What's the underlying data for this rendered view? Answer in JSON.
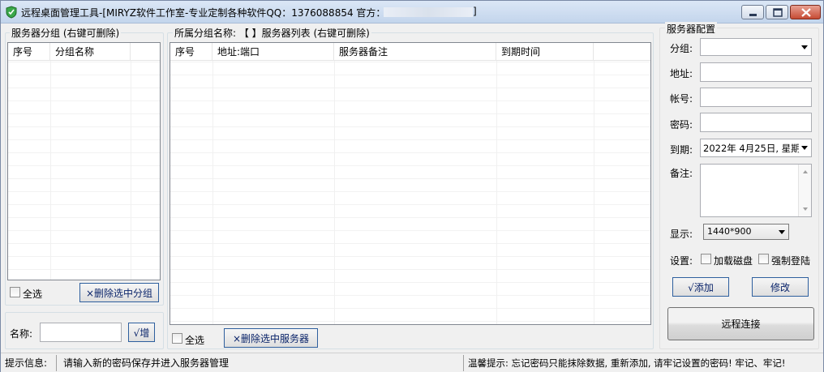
{
  "window": {
    "title": "远程桌面管理工具-[MIRYZ软件工作室-专业定制各种软件QQ：1376088854 官方：",
    "title_end": "]",
    "minimize_glyph": "minimize-icon",
    "maximize_glyph": "maximize-icon",
    "close_glyph": "close-icon"
  },
  "groups_panel": {
    "title": "服务器分组 (右键可删除)",
    "columns": [
      "序号",
      "分组名称",
      ""
    ],
    "select_all": "全选",
    "delete_button": "×删除选中分组",
    "name_label": "名称:",
    "name_value": "",
    "add_button": "√增"
  },
  "servers_panel": {
    "title": "所属分组名称: 【 】服务器列表 (右键可删除)",
    "columns": [
      "序号",
      "地址:端口",
      "服务器备注",
      "到期时间",
      ""
    ],
    "select_all": "全选",
    "delete_button": "×删除选中服务器"
  },
  "config_panel": {
    "title": "服务器配置",
    "group_label": "分组:",
    "group_value": "",
    "address_label": "地址:",
    "address_value": "",
    "account_label": "帐号:",
    "account_value": "",
    "password_label": "密码:",
    "password_value": "",
    "expiry_label": "到期:",
    "expiry_value": "2022年 4月25日, 星期",
    "note_label": "备注:",
    "note_value": "",
    "display_label": "显示:",
    "display_value": "1440*900",
    "settings_label": "设置:",
    "load_disk_label": "加载磁盘",
    "force_login_label": "强制登陆",
    "add_button": "√添加",
    "edit_button": "修改",
    "connect_button": "远程连接"
  },
  "status": {
    "hint_label": "提示信息:",
    "hint_text": "请输入新的密码保存并进入服务器管理",
    "warm_tip": "温馨提示: 忘记密码只能抹除数据, 重新添加, 请牢记设置的密码! 牢记、牢记!"
  },
  "colors": {
    "accent_text": "#0a246a",
    "window_bg": "#f0f0f0",
    "close_button": "#c64b34"
  }
}
